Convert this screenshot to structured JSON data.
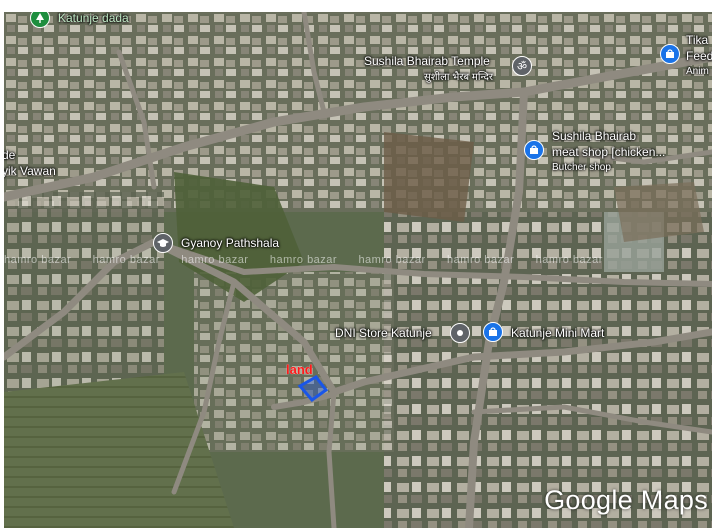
{
  "map": {
    "places": [
      {
        "id": "katunje-dada",
        "label": "Katunje dada"
      },
      {
        "id": "sushila-temple",
        "label": "Sushila Bhairab Temple",
        "sub": "सुशीला भैरब मन्दिर"
      },
      {
        "id": "tika-feed",
        "label": "Tika",
        "sub": "Feed",
        "sub2": "Anim"
      },
      {
        "id": "meat-shop",
        "label": "Sushila Bhairab",
        "line2": "meat shop [chicken...",
        "sub": "Butcher shop"
      },
      {
        "id": "vawan",
        "label": "de",
        "line2": "yik Vawan"
      },
      {
        "id": "gyanoy",
        "label": "Gyanoy Pathshala"
      },
      {
        "id": "dni-store",
        "label": "DNI Store Katunje"
      },
      {
        "id": "mini-mart",
        "label": "Katunje Mini Mart"
      }
    ],
    "land_label": "land",
    "watermark": "hamro bazar",
    "brand": "Google Maps",
    "colors": {
      "pin_green": "#1e8e3e",
      "pin_blue": "#1a73e8",
      "pin_gray": "#5f6368",
      "marker_blue": "#1a56e8",
      "land_red": "#ff1a1a"
    }
  }
}
